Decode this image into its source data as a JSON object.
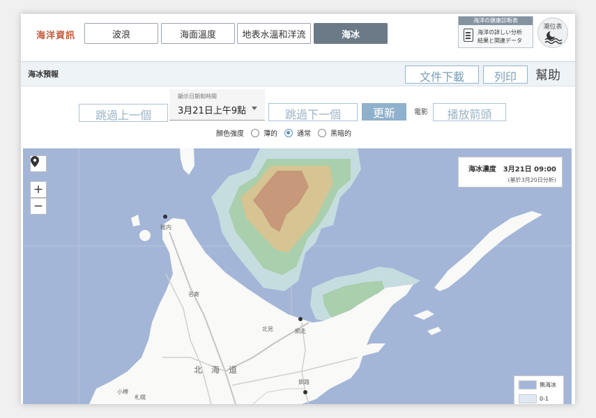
{
  "header": {
    "brand": "海洋資訊",
    "tabs": [
      {
        "label": "波浪",
        "active": false
      },
      {
        "label": "海面溫度",
        "active": false
      },
      {
        "label": "地表水溫和洋流",
        "active": false
      },
      {
        "label": "海冰",
        "active": true
      }
    ],
    "health": {
      "head": "海洋の健康診断表",
      "line1": "海洋の詳しい分析",
      "line2": "結果と関連データ",
      "icon": "document-icon"
    },
    "tide": {
      "label": "潮位表",
      "icon": "moon-wave-icon"
    }
  },
  "forecast": {
    "title": "海冰預報",
    "download_label": "文件下載",
    "print_label": "列印",
    "help_label": "幫助"
  },
  "controls": {
    "prev_label": "跳過上一個",
    "date_label": "顯示日期和時間",
    "date_value": "3月21日上午9點",
    "next_label": "跳過下一個",
    "update_label": "更新",
    "movie_label": "電影",
    "play_label": "播放箭頭",
    "color_label": "顏色強度",
    "color_options": [
      {
        "label": "薄的",
        "selected": false
      },
      {
        "label": "通常",
        "selected": true
      },
      {
        "label": "黑暗的",
        "selected": false
      }
    ]
  },
  "map": {
    "info_title": "海冰濃度　3月21日 09:00",
    "info_sub": "(基於3月20日分析)",
    "zoom_in": "+",
    "zoom_out": "−",
    "legend": [
      {
        "label": "無海冰",
        "color": "#a3b6d8"
      },
      {
        "label": "0-1",
        "color": "#dfe9f3"
      }
    ],
    "place_labels": {
      "wakkanai": "稚内",
      "abashiri": "網走",
      "kushiro": "釧路",
      "kitami": "北見",
      "nayoro": "名寄",
      "sapporo": "札幌",
      "otaru": "小樽",
      "hokkaido": [
        "北",
        "海",
        "道"
      ]
    }
  },
  "colors": {
    "ocean": "#a3b6d8",
    "land": "#f9f9f7",
    "ice_low": "#c6dde0",
    "ice_mid": "#a9cfad",
    "ice_high": "#d6c492",
    "ice_peak": "#c7987a",
    "accent": "#6b7a86"
  }
}
